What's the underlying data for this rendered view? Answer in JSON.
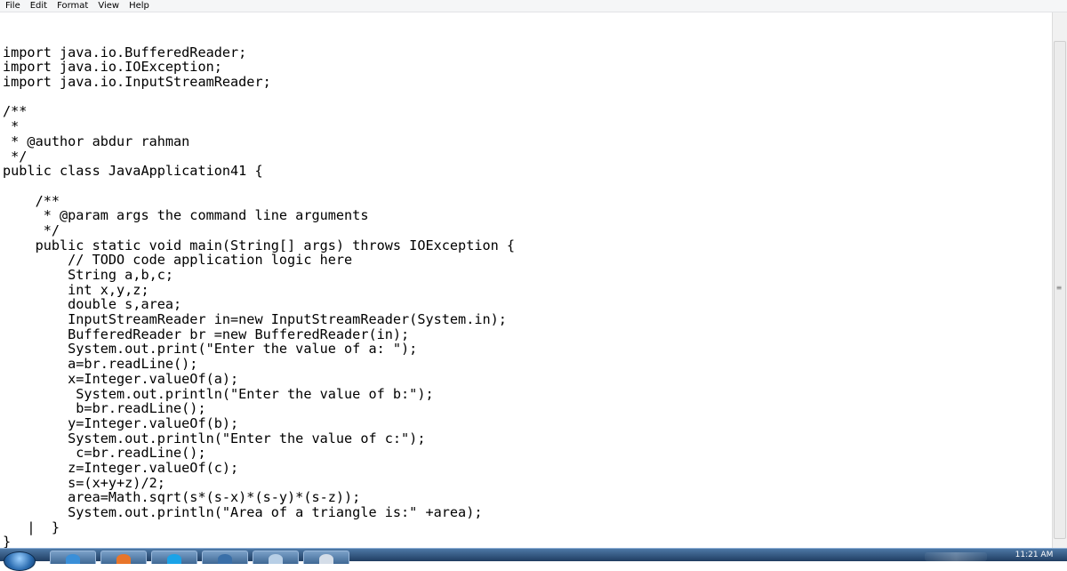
{
  "menu": [
    "File",
    "Edit",
    "Format",
    "View",
    "Help"
  ],
  "editor": {
    "lines": [
      "",
      "import java.io.BufferedReader;",
      "import java.io.IOException;",
      "import java.io.InputStreamReader;",
      "",
      "/**",
      " *",
      " * @author abdur rahman",
      " */",
      "public class JavaApplication41 {",
      "",
      "    /**",
      "     * @param args the command line arguments",
      "     */",
      "    public static void main(String[] args) throws IOException {",
      "        // TODO code application logic here",
      "        String a,b,c;",
      "        int x,y,z;",
      "        double s,area;",
      "        InputStreamReader in=new InputStreamReader(System.in);",
      "        BufferedReader br =new BufferedReader(in);",
      "        System.out.print(\"Enter the value of a: \");",
      "        a=br.readLine();",
      "        x=Integer.valueOf(a);",
      "         System.out.println(\"Enter the value of b:\");",
      "         b=br.readLine();",
      "        y=Integer.valueOf(b);",
      "        System.out.println(\"Enter the value of c:\");",
      "         c=br.readLine();",
      "        z=Integer.valueOf(c);",
      "        s=(x+y+z)/2;",
      "        area=Math.sqrt(s*(s-x)*(s-y)*(s-z));",
      "        System.out.println(\"Area of a triangle is:\" +area);",
      "   |  }",
      "}"
    ]
  },
  "taskbar": {
    "clock": "11:21 AM",
    "pinned": [
      {
        "name": "ie-icon",
        "color": "#3a8fd8"
      },
      {
        "name": "firefox-icon",
        "color": "#e8752a"
      },
      {
        "name": "skype-icon",
        "color": "#1aa3e8"
      },
      {
        "name": "netbeans-icon",
        "color": "#3a6fa8"
      },
      {
        "name": "notepad-icon",
        "color": "#b8cfe6"
      },
      {
        "name": "paint-icon",
        "color": "#d4dde8"
      }
    ]
  }
}
